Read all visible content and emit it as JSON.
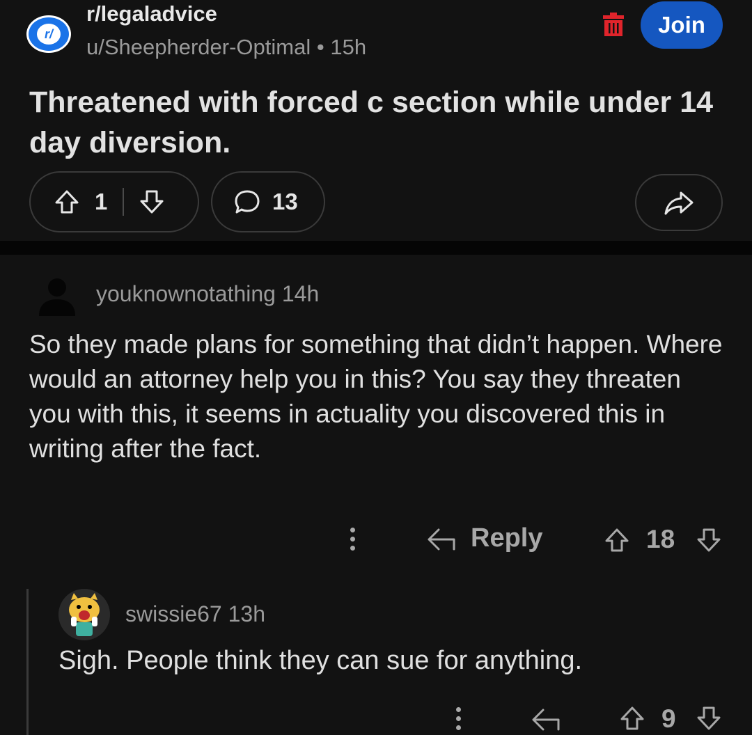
{
  "post": {
    "subreddit": "r/legaladvice",
    "avatar_text": "r/",
    "author": "u/Sheepherder-Optimal",
    "separator": "•",
    "age": "15h",
    "join_label": "Join",
    "title": "Threatened with forced c section while under 14 day diversion.",
    "score": "1",
    "comment_count": "13",
    "icons": {
      "trash": "trash-icon",
      "upvote": "upvote-arrow-icon",
      "downvote": "downvote-arrow-icon",
      "comment": "comment-bubble-icon",
      "share": "share-arrow-icon"
    },
    "colors": {
      "join_bg": "#1557c0",
      "trash": "#e0242b",
      "avatar": "#1a73e8"
    }
  },
  "comments": [
    {
      "username": "youknownotathing",
      "age": "14h",
      "body": "So they made plans for something that didn’t happen. Where would an attorney help you in this? You say they threaten you with this, it seems in actuality you discovered this in writing after the fact.",
      "reply_label": "Reply",
      "score": "18"
    },
    {
      "username": "swissie67",
      "age": "13h",
      "body": "Sigh. People think they can sue for anything.",
      "score": "9"
    }
  ]
}
